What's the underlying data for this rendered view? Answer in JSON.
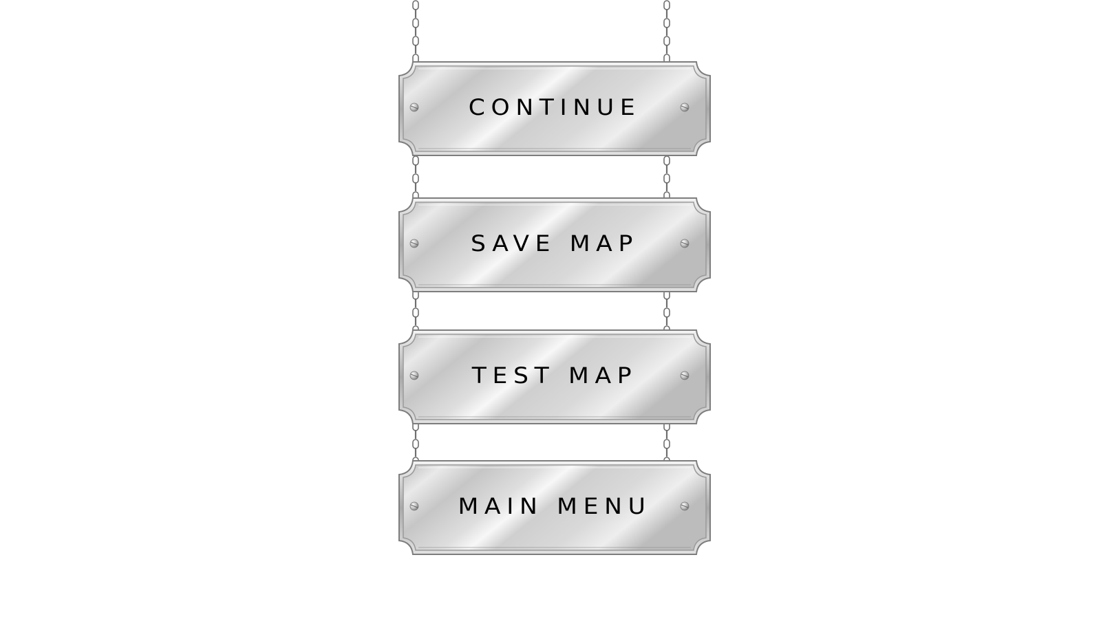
{
  "menu": {
    "items": [
      {
        "label": "CONTINUE",
        "name": "continue-button"
      },
      {
        "label": "SAVE MAP",
        "name": "save-map-button"
      },
      {
        "label": "TEST MAP",
        "name": "test-map-button"
      },
      {
        "label": "MAIN MENU",
        "name": "main-menu-button"
      }
    ]
  },
  "colors": {
    "background": "#ffffff",
    "plate_light": "#f2f2f2",
    "plate_mid": "#c9c9c9",
    "plate_dark": "#8f8f8f",
    "chain": "#777777",
    "label": "#000000"
  },
  "icons": {
    "screw": "screw-icon",
    "chain": "chain-icon"
  }
}
